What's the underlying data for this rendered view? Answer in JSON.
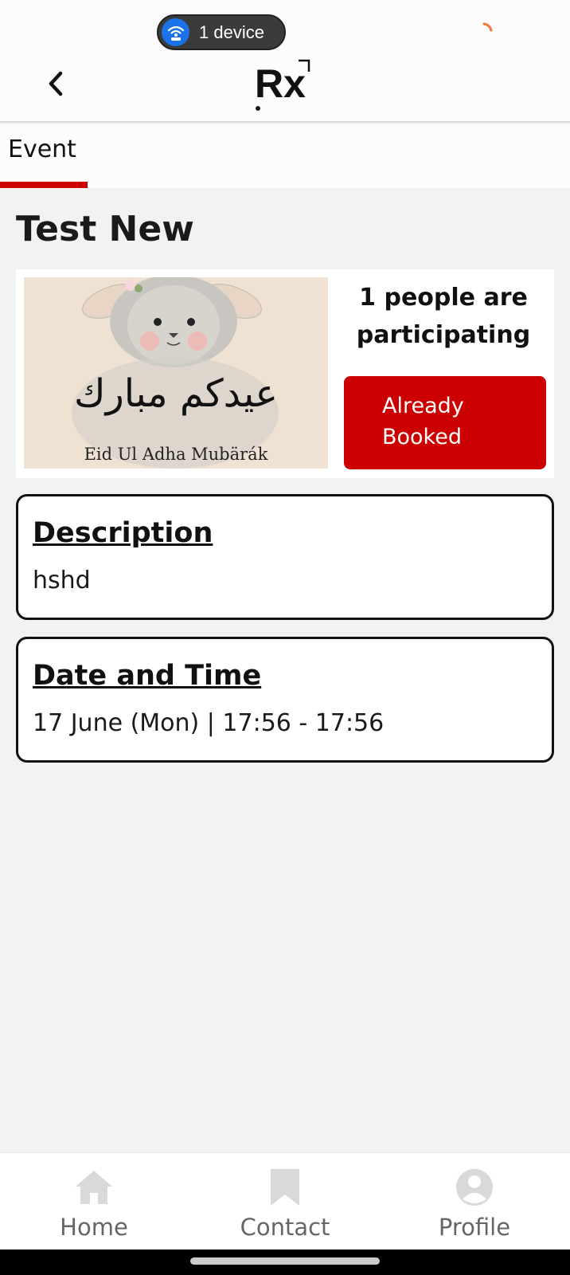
{
  "status_bar": {
    "device_pill": "1 device"
  },
  "header": {
    "back_icon": "chevron-left-icon",
    "logo_text": "Rx"
  },
  "tabs": [
    {
      "label": "Event",
      "active": true
    }
  ],
  "event": {
    "title": "Test New",
    "image": {
      "arabic_text": "عيدكم مبارك",
      "caption": "Eid Ul Adha Mubärák"
    },
    "participants_text": "1 people are participating",
    "booked_label": "Already Booked",
    "booked_color": "#cc0000"
  },
  "description": {
    "heading": "Description",
    "text": "hshd"
  },
  "date_time": {
    "heading": "Date and Time",
    "text": "17 June (Mon) | 17:56 - 17:56"
  },
  "bottom_nav": [
    {
      "label": "Home",
      "icon": "home-icon"
    },
    {
      "label": "Contact",
      "icon": "bookmark-icon"
    },
    {
      "label": "Profile",
      "icon": "user-icon"
    }
  ],
  "colors": {
    "accent": "#cc0000",
    "background": "#f2f2f2",
    "nav_inactive": "#666666"
  }
}
